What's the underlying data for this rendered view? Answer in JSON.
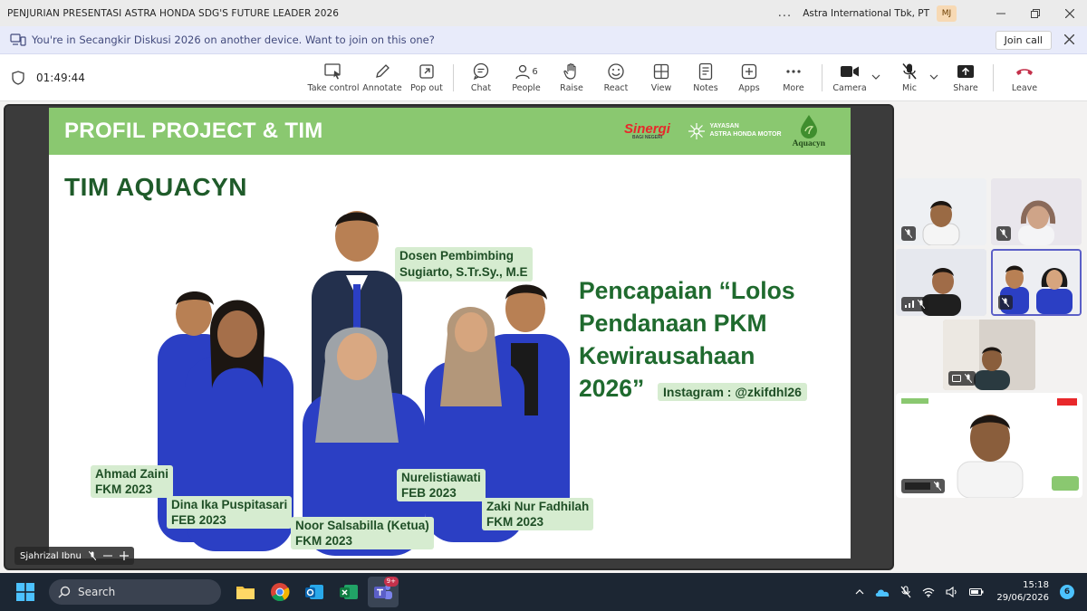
{
  "window": {
    "title": "PENJURIAN PRESENTASI ASTRA HONDA SDG'S FUTURE LEADER 2026",
    "more_label": "...",
    "org_name": "Astra International Tbk, PT",
    "user_initials": "MJ"
  },
  "notification": {
    "text": "You're in Secangkir Diskusi 2026 on another device. Want to join on this one?",
    "join_label": "Join call"
  },
  "toolbar": {
    "timer": "01:49:44",
    "people_count": "6",
    "buttons": {
      "take_control": "Take control",
      "annotate": "Annotate",
      "pop_out": "Pop out",
      "chat": "Chat",
      "people": "People",
      "raise": "Raise",
      "react": "React",
      "view": "View",
      "notes": "Notes",
      "apps": "Apps",
      "more": "More",
      "camera": "Camera",
      "mic": "Mic",
      "share": "Share",
      "leave": "Leave"
    }
  },
  "slide": {
    "header_title": "PROFIL PROJECT & TIM",
    "logos": {
      "sinergi": "Sinergi",
      "sinergi_sub": "BAGI NEGERI",
      "yayasan_line1": "YAYASAN",
      "yayasan_line2": "ASTRA HONDA MOTOR",
      "aquacyn": "Aquacyn"
    },
    "team_title": "TIM AQUACYN",
    "achievement_lines": [
      "Pencapaian “Lolos",
      "Pendanaan PKM",
      "Kewirausahaan",
      "2026”"
    ],
    "instagram": "Instagram : @zkifdhl26",
    "members": {
      "dosen_line1": "Dosen Pembimbing",
      "dosen_line2": "Sugiarto, S.Tr.Sy., M.E",
      "ahmad_line1": "Ahmad Zaini",
      "ahmad_line2": "FKM 2023",
      "dina_line1": "Dina Ika Puspitasari",
      "dina_line2": "FEB 2023",
      "noor_line1": "Noor Salsabilla (Ketua)",
      "noor_line2": "FKM 2023",
      "nurel_line1": "Nurelistiawati",
      "nurel_line2": "FEB 2023",
      "zaki_line1": "Zaki Nur Fadhilah",
      "zaki_line2": "FKM 2023"
    }
  },
  "presenter": {
    "name": "Sjahrizal Ibnu"
  },
  "taskbar": {
    "search_label": "Search",
    "teams_badge": "9+",
    "time": "15:18",
    "date": "29/06/2026",
    "notification_count": "6"
  },
  "colors": {
    "teams_purple": "#5b5fc7",
    "slide_header_green": "#8ac870",
    "slide_text_green": "#1f6a2e",
    "leave_red": "#c4314b",
    "jacket_blue": "#2b3fc4"
  }
}
